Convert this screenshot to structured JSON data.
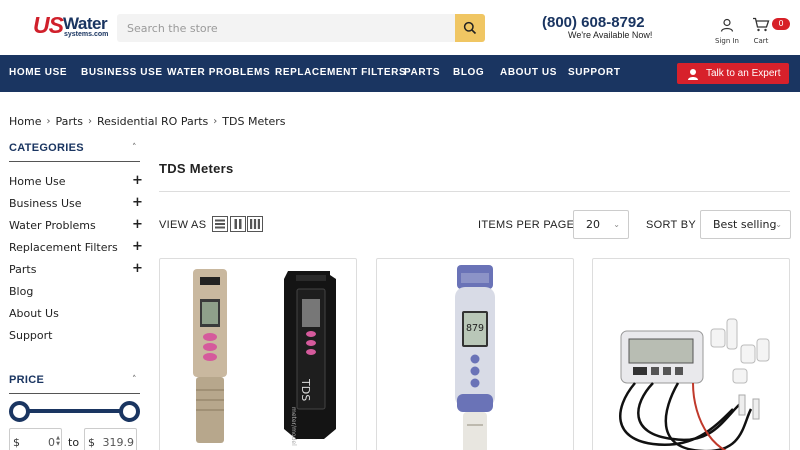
{
  "header": {
    "logo": {
      "us": "US",
      "water": "Water",
      "systems": "systems.com"
    },
    "search_placeholder": "Search the store",
    "phone": "(800) 608-8792",
    "availability": "We're Available Now!",
    "sign_in": "Sign In",
    "cart_label": "Cart",
    "cart_count": "0"
  },
  "nav": {
    "items": [
      "HOME USE",
      "BUSINESS USE",
      "WATER PROBLEMS",
      "REPLACEMENT FILTERS",
      "PARTS",
      "BLOG",
      "ABOUT US",
      "SUPPORT"
    ],
    "expert_button": "Talk to an Expert"
  },
  "breadcrumb": [
    "Home",
    "Parts",
    "Residential RO Parts",
    "TDS Meters"
  ],
  "sidebar": {
    "categories_heading": "CATEGORIES",
    "categories": [
      {
        "label": "Home Use",
        "expandable": true
      },
      {
        "label": "Business Use",
        "expandable": true
      },
      {
        "label": "Water Problems",
        "expandable": true
      },
      {
        "label": "Replacement Filters",
        "expandable": true
      },
      {
        "label": "Parts",
        "expandable": true
      },
      {
        "label": "Blog",
        "expandable": false
      },
      {
        "label": "About Us",
        "expandable": false
      },
      {
        "label": "Support",
        "expandable": false
      }
    ],
    "price_heading": "PRICE",
    "price_min": "0",
    "price_max": "319.9",
    "currency": "$",
    "to_label": "to"
  },
  "main": {
    "title": "TDS Meters",
    "view_as": "VIEW AS",
    "items_per_page_label": "ITEMS PER PAGE",
    "items_per_page": "20",
    "sort_by_label": "SORT BY",
    "sort_by": "Best selling"
  },
  "colors": {
    "navy": "#1a3561",
    "red": "#d7212b",
    "search_button": "#f0c663"
  }
}
